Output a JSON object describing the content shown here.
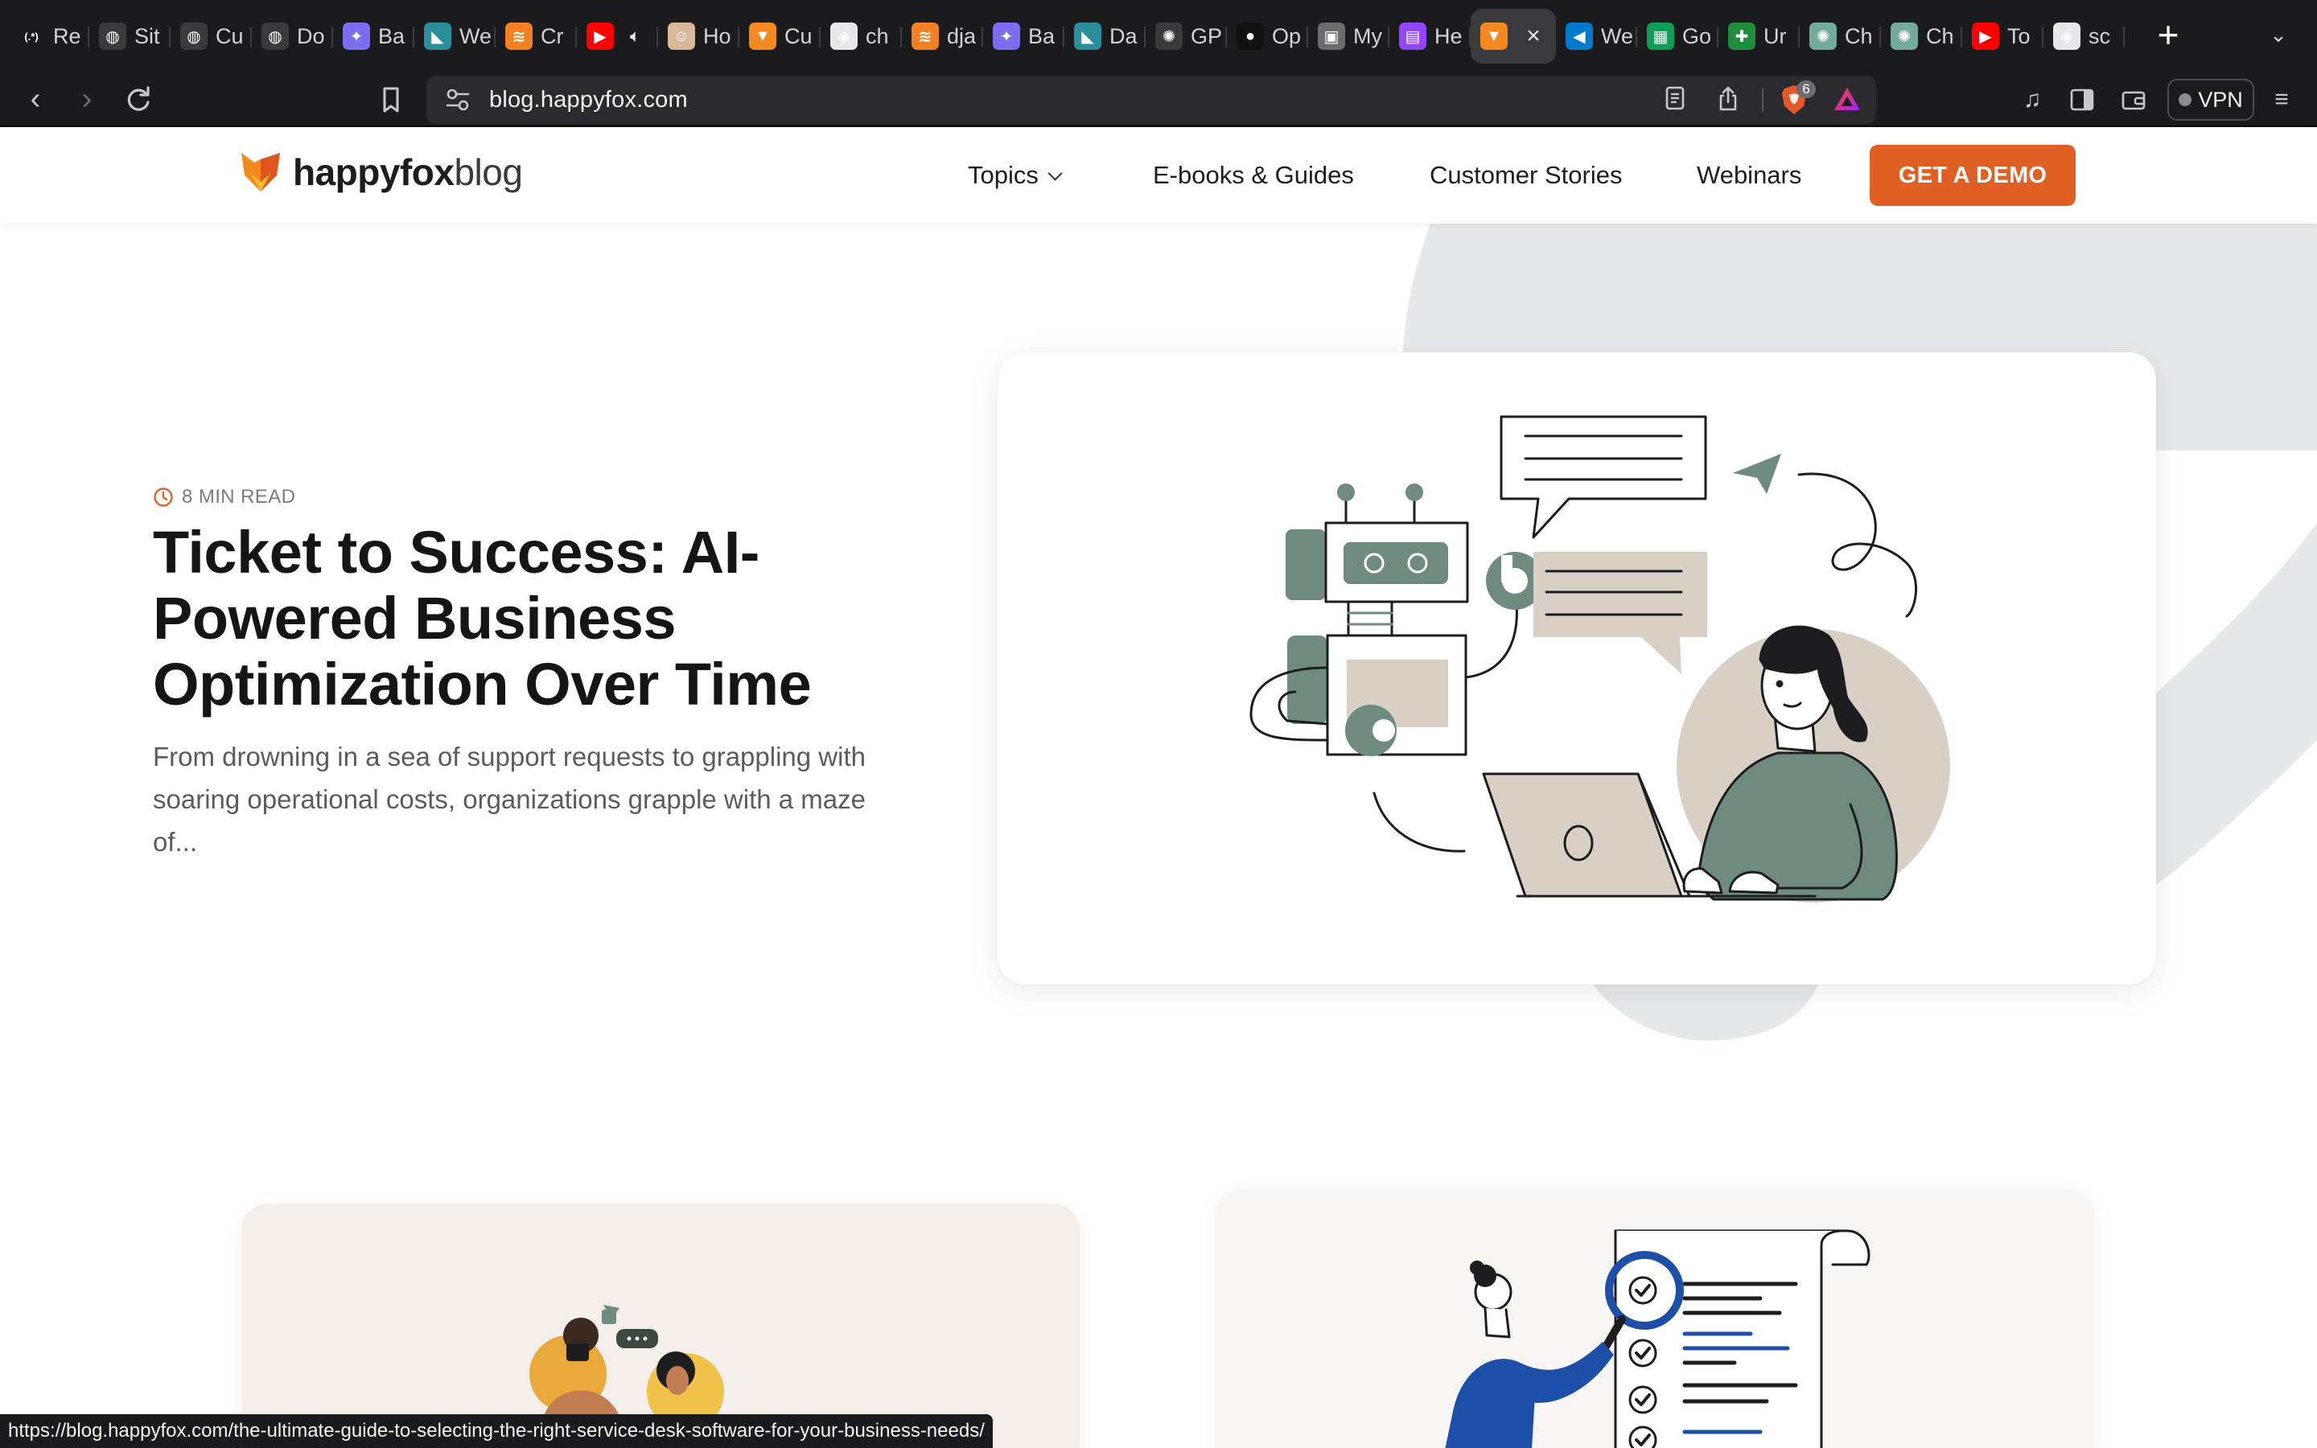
{
  "browser": {
    "tabs": [
      {
        "label": "Re",
        "icon": "regex-icon",
        "color": "#1b1b1e"
      },
      {
        "label": "Sit",
        "icon": "globe-icon",
        "color": "#3a3a3e"
      },
      {
        "label": "Cu",
        "icon": "globe-icon",
        "color": "#3a3a3e"
      },
      {
        "label": "Do",
        "icon": "globe-icon",
        "color": "#3a3a3e"
      },
      {
        "label": "Ba",
        "icon": "sparkle-icon",
        "color": "#7c6cf0"
      },
      {
        "label": "We",
        "icon": "bird-icon",
        "color": "#2a8f9a"
      },
      {
        "label": "Cr",
        "icon": "stackoverflow-icon",
        "color": "#f48024"
      },
      {
        "label": "",
        "icon": "youtube-icon",
        "color": "#ff0000"
      },
      {
        "label": "Ho",
        "icon": "avatar-icon",
        "color": "#d9b89a"
      },
      {
        "label": "Cu",
        "icon": "happyfox-icon",
        "color": "#f28a1f"
      },
      {
        "label": "ch",
        "icon": "brave-search-icon",
        "color": "#e8e8ea"
      },
      {
        "label": "dja",
        "icon": "stackoverflow-icon",
        "color": "#f48024"
      },
      {
        "label": "Ba",
        "icon": "sparkle-icon",
        "color": "#7c6cf0"
      },
      {
        "label": "Da",
        "icon": "bird-icon",
        "color": "#2a8f9a"
      },
      {
        "label": "GP",
        "icon": "openai-icon",
        "color": "#3a3a3e"
      },
      {
        "label": "Op",
        "icon": "github-icon",
        "color": "#111111"
      },
      {
        "label": "My",
        "icon": "lock-icon",
        "color": "#6b6b70"
      },
      {
        "label": "He",
        "icon": "twitch-icon",
        "color": "#9146ff"
      },
      {
        "label": "",
        "icon": "happyfox-icon",
        "color": "#f28a1f",
        "active": true
      },
      {
        "label": "We",
        "icon": "vscode-icon",
        "color": "#007acc"
      },
      {
        "label": "Go",
        "icon": "sheets-icon",
        "color": "#0f9d58"
      },
      {
        "label": "Ur",
        "icon": "plus-sheet-icon",
        "color": "#1e8e3e"
      },
      {
        "label": "Ch",
        "icon": "openai-icon",
        "color": "#74aa9c"
      },
      {
        "label": "Ch",
        "icon": "openai-icon",
        "color": "#74aa9c"
      },
      {
        "label": "To",
        "icon": "youtube-icon",
        "color": "#ff0000"
      },
      {
        "label": "sc",
        "icon": "brave-search-icon",
        "color": "#e8e8ea"
      }
    ],
    "new_tab": "+",
    "url": "blog.happyfox.com",
    "shield_count": "6",
    "vpn_label": "VPN",
    "status_url": "https://blog.happyfox.com/the-ultimate-guide-to-selecting-the-right-service-desk-software-for-your-business-needs/"
  },
  "site": {
    "logo_brand": "happyfox",
    "logo_suffix": "blog",
    "nav": {
      "topics": "Topics",
      "ebooks": "E-books & Guides",
      "stories": "Customer Stories",
      "webinars": "Webinars"
    },
    "cta": "GET A DEMO",
    "accent": "#e06024"
  },
  "hero": {
    "read_time": "8 MIN READ",
    "title": "Ticket to Success: AI-Powered Business Optimization Over Time",
    "excerpt": "From drowning in a sea of support requests to grappling with soaring operational costs, organizations grapple with a maze of..."
  }
}
